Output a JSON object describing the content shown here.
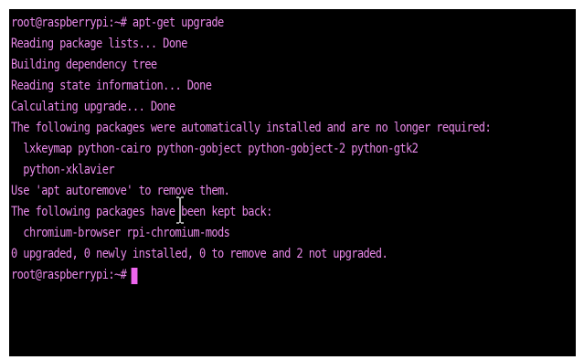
{
  "terminal": {
    "text_color": "#e888e8",
    "background": "#000000",
    "cursor_color": "#ee66ee",
    "lines": [
      "root@raspberrypi:~# apt-get upgrade",
      "Reading package lists... Done",
      "Building dependency tree",
      "Reading state information... Done",
      "Calculating upgrade... Done",
      "The following packages were automatically installed and are no longer required:",
      "  lxkeymap python-cairo python-gobject python-gobject-2 python-gtk2",
      "  python-xklavier",
      "Use 'apt autoremove' to remove them.",
      "The following packages have been kept back:",
      "  chromium-browser rpi-chromium-mods",
      "0 upgraded, 0 newly installed, 0 to remove and 2 not upgraded."
    ],
    "prompt": "root@raspberrypi:~#",
    "mouse_pointer": "text-cursor-icon"
  }
}
